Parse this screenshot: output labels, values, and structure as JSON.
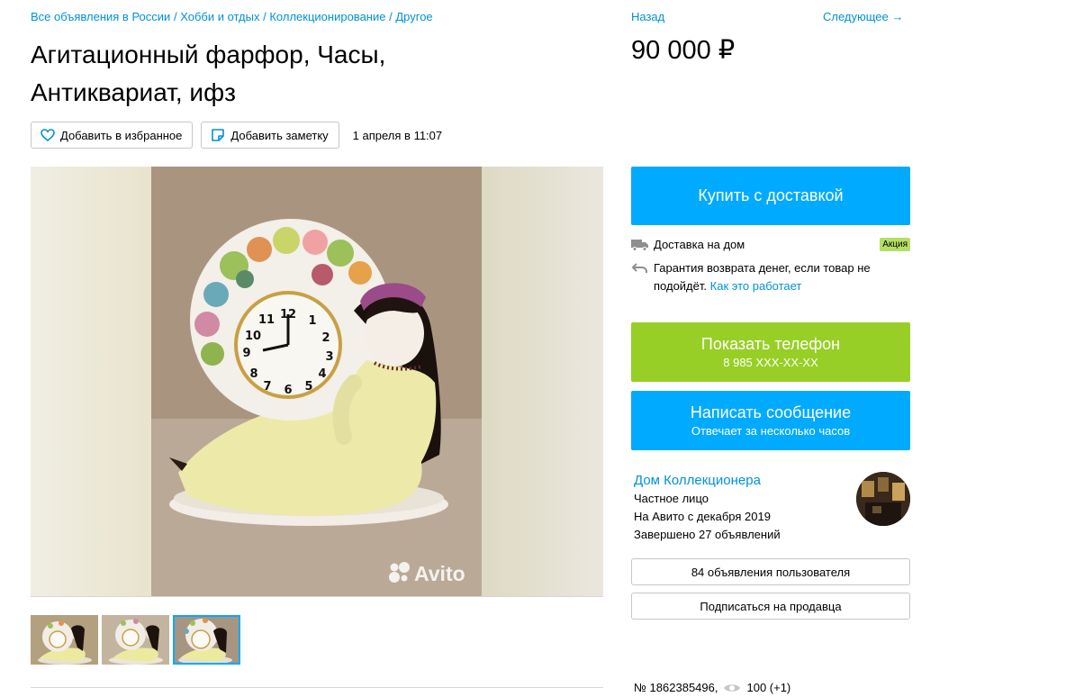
{
  "breadcrumbs": {
    "item1": "Все объявления в России",
    "item2": "Хобби и отдых",
    "item3": "Коллекционирование",
    "item4": "Другое",
    "separator": "/"
  },
  "title": "Агитационный фарфор, Часы, Антиквариат, ифз",
  "actions": {
    "favorite_label": "Добавить в избранное",
    "note_label": "Добавить заметку",
    "date": "1 апреля в 11:07"
  },
  "gallery": {
    "watermark": "Avito",
    "thumbnail_count": 3,
    "active_thumbnail": 3
  },
  "nav": {
    "back_label": "Назад",
    "next_label": "Следующее →"
  },
  "price": "90 000 ₽",
  "buy_button": {
    "label": "Купить с доставкой"
  },
  "delivery": {
    "home_delivery": "Доставка на дом",
    "promo_badge": "Акция",
    "guarantee_text": "Гарантия возврата денег, если товар не подойдёт.",
    "how_it_works_link": "Как это работает"
  },
  "phone_button": {
    "label": "Показать телефон",
    "number": "8 985 XXX-XX-XX"
  },
  "message_button": {
    "label": "Написать сообщение",
    "sub": "Отвечает за несколько часов"
  },
  "seller": {
    "name": "Дом Коллекционера",
    "type": "Частное лицо",
    "since": "На Авито с декабря 2019",
    "completed": "Завершено 27 объявлений"
  },
  "seller_listings_button": "84 объявления пользователя",
  "subscribe_button": "Подписаться на продавца",
  "listing_meta": {
    "id": "№ 1862385496,",
    "views": "100 (+1)"
  },
  "colors": {
    "link": "#0091d9",
    "primary_blue": "#00aaff",
    "green": "#97cf26",
    "promo_bg": "#b3e063"
  }
}
